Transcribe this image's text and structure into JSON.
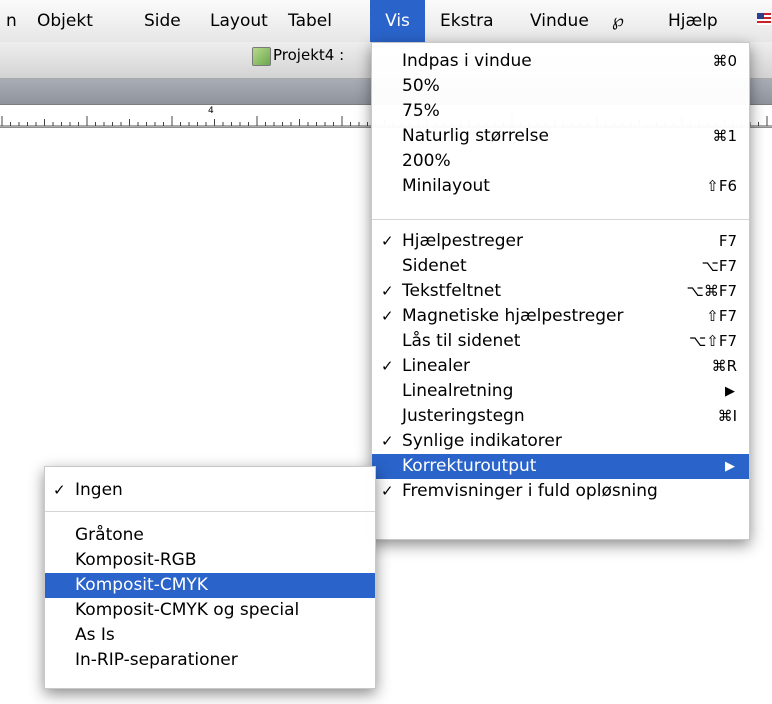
{
  "menubar": {
    "items": [
      "n",
      "Objekt",
      "Side",
      "Layout",
      "Tabel",
      "Vis",
      "Ekstra",
      "Vindue",
      "℘",
      "Hjælp"
    ],
    "active_item": "Vis"
  },
  "window": {
    "title": "Projekt4 : "
  },
  "ruler": {
    "label": "4"
  },
  "vis_menu": {
    "items": [
      {
        "check": "",
        "label": "Indpas i vindue",
        "shortcut": "⌘0"
      },
      {
        "check": "",
        "label": "50%",
        "shortcut": ""
      },
      {
        "check": "",
        "label": "75%",
        "shortcut": ""
      },
      {
        "check": "",
        "label": "Naturlig størrelse",
        "shortcut": "⌘1"
      },
      {
        "check": "",
        "label": "200%",
        "shortcut": ""
      },
      {
        "check": "",
        "label": "Minilayout",
        "shortcut": "⇧F6"
      },
      {
        "check": "✓",
        "label": "Hjælpestreger",
        "shortcut": "F7"
      },
      {
        "check": "",
        "label": "Sidenet",
        "shortcut": "⌥F7"
      },
      {
        "check": "✓",
        "label": "Tekstfeltnet",
        "shortcut": "⌥⌘F7"
      },
      {
        "check": "✓",
        "label": "Magnetiske hjælpestreger",
        "shortcut": "⇧F7"
      },
      {
        "check": "",
        "label": "Lås til sidenet",
        "shortcut": "⌥⇧F7"
      },
      {
        "check": "✓",
        "label": "Linealer",
        "shortcut": "⌘R"
      },
      {
        "check": "",
        "label": "Linealretning",
        "shortcut": "▶"
      },
      {
        "check": "",
        "label": "Justeringstegn",
        "shortcut": "⌘I"
      },
      {
        "check": "✓",
        "label": "Synlige indikatorer",
        "shortcut": ""
      },
      {
        "check": "",
        "label": "Korrekturoutput",
        "shortcut": "▶"
      },
      {
        "check": "✓",
        "label": "Fremvisninger i fuld opløsning",
        "shortcut": ""
      }
    ],
    "highlighted": "Korrekturoutput"
  },
  "submenu": {
    "items": [
      {
        "check": "✓",
        "label": "Ingen"
      },
      {
        "check": "",
        "label": "Gråtone"
      },
      {
        "check": "",
        "label": "Komposit-RGB"
      },
      {
        "check": "",
        "label": "Komposit-CMYK"
      },
      {
        "check": "",
        "label": "Komposit-CMYK og special"
      },
      {
        "check": "",
        "label": "As Is"
      },
      {
        "check": "",
        "label": "In-RIP-separationer"
      }
    ],
    "highlighted": "Komposit-CMYK"
  },
  "colors": {
    "highlight": "#2a63c9",
    "menubar": "#ededed",
    "strip": "#9c9fa8"
  }
}
